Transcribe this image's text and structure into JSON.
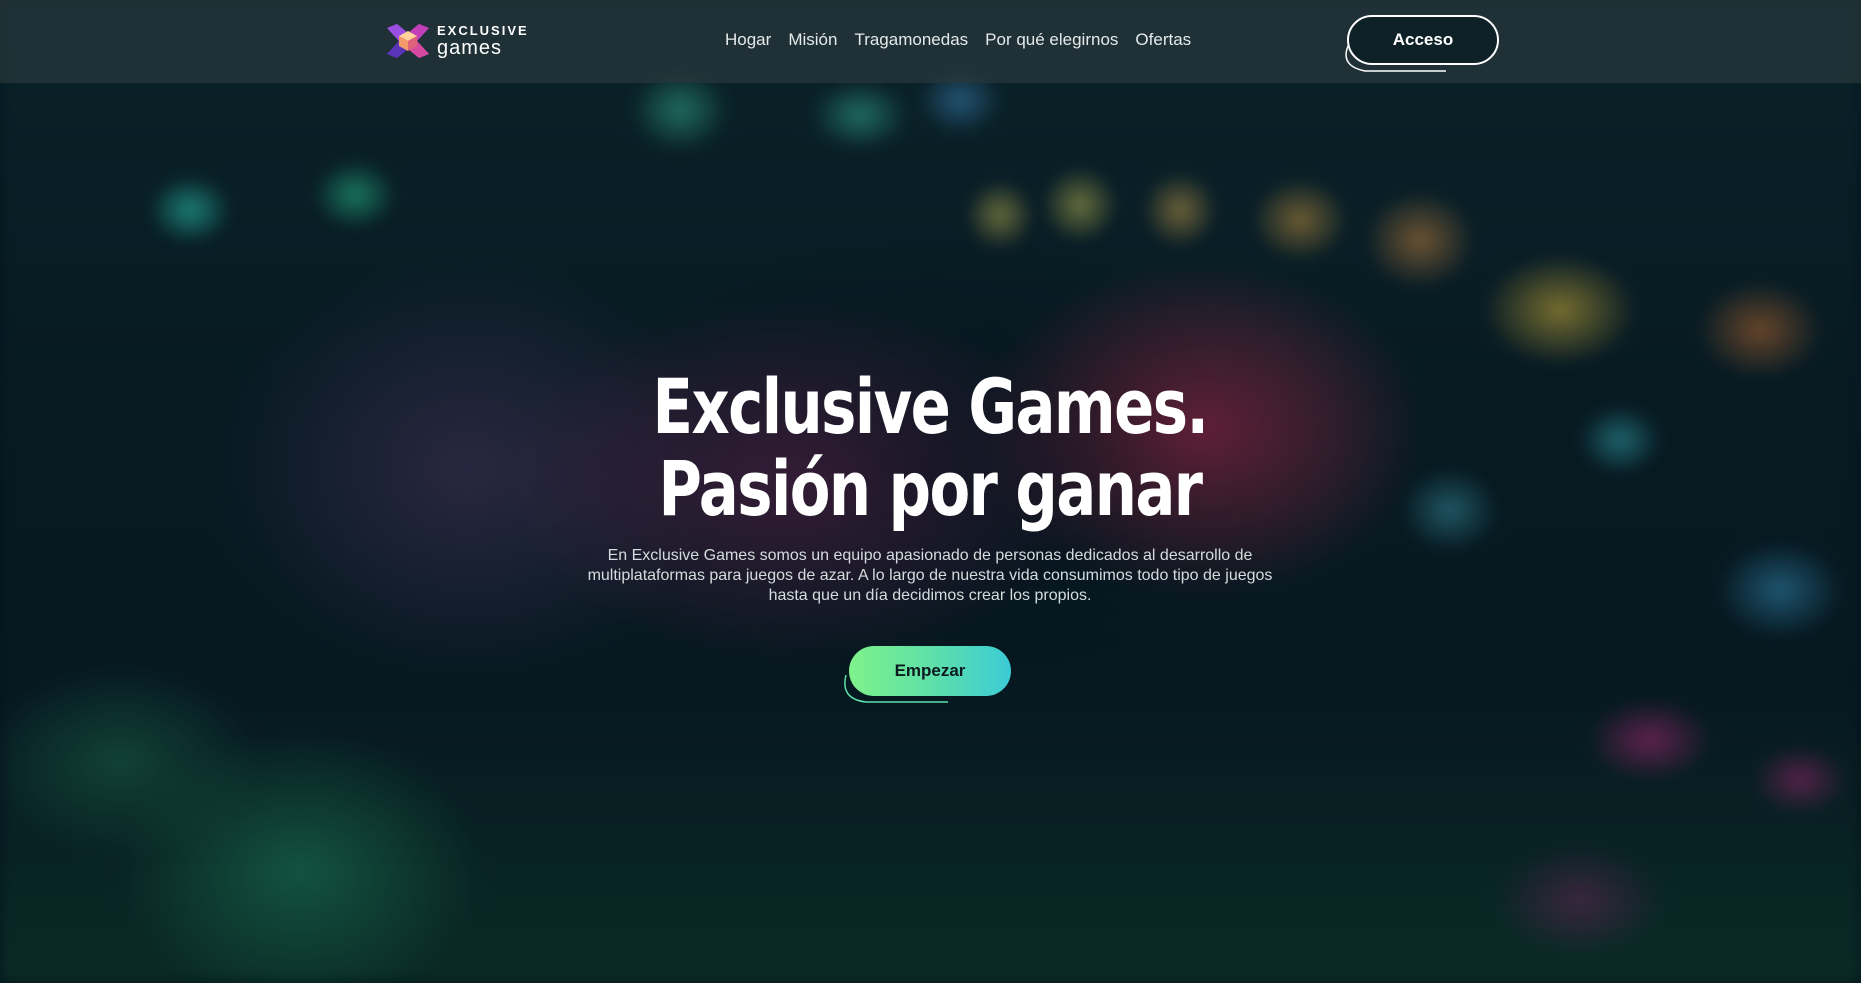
{
  "brand": {
    "line1": "EXCLUSIVE",
    "line2": "games",
    "icon": "cube-logo-icon"
  },
  "nav": {
    "items": [
      {
        "label": "Hogar"
      },
      {
        "label": "Misión"
      },
      {
        "label": "Tragamonedas"
      },
      {
        "label": "Por qué elegirnos"
      },
      {
        "label": "Ofertas"
      }
    ]
  },
  "header": {
    "login_label": "Acceso"
  },
  "hero": {
    "title_line1": "Exclusive Games.",
    "title_line2": "Pasión por ganar",
    "description": "En Exclusive Games somos un equipo apasionado de personas dedicados al desarrollo de multiplataformas para juegos de azar. A lo largo de nuestra vida consumimos todo tipo de juegos hasta que un día decidimos crear los propios.",
    "cta_label": "Empezar"
  },
  "colors": {
    "accent_start": "#7ff28a",
    "accent_end": "#3ccbd6",
    "header_bg": "#28373c",
    "text": "#ffffff"
  }
}
